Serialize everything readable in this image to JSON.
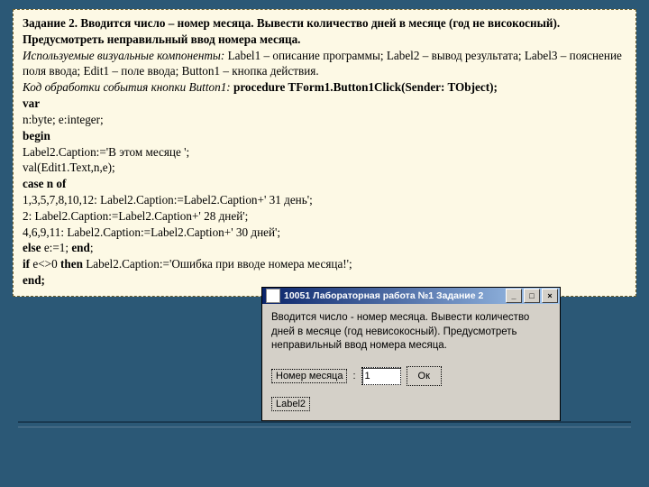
{
  "task": {
    "title_prefix": "Задание 2.",
    "title_body": "Вводится число – номер месяца. Вывести количество дней в месяце (год не високосный). Предусмотреть неправильный ввод номера месяца.",
    "components_label": "Используемые визуальные компоненты:",
    "components_text": " Label1 – описание программы; Label2 – вывод результата; Label3 – пояснение поля ввода; Edit1 – поле ввода; Button1 – кнопка действия.",
    "handler_label": "Код обработки события кнопки Button1:",
    "handler_sig": " procedure TForm1.Button1Click(Sender: TObject);"
  },
  "code": {
    "l1": "var",
    "l2": "n:byte;  e:integer;",
    "l3": "begin",
    "l4": "Label2.Caption:='В этом месяце ';",
    "l5": "val(Edit1.Text,n,e);",
    "l6": "case n of",
    "l7": "1,3,5,7,8,10,12: Label2.Caption:=Label2.Caption+' 31 день';",
    "l8": "2:                  Label2.Caption:=Label2.Caption+' 28 дней';",
    "l9": "4,6,9,11:        Label2.Caption:=Label2.Caption+' 30 дней';",
    "l10": "else e:=1; end;",
    "l11": "if e<>0 then  Label2.Caption:='Ошибка при вводе номера месяца!';",
    "l12": "end;"
  },
  "window": {
    "title": "10051 Лабораторная работа №1  Задание 2",
    "min": "_",
    "max": "□",
    "close": "×",
    "description": "Вводится число - номер месяца. Вывести количество дней в месяце (год невисокосный). Предусмотреть неправильный ввод номера месяца.",
    "input_label": "Номер месяца",
    "input_value": "1",
    "ok_label": "Ок",
    "label2": "Label2"
  }
}
